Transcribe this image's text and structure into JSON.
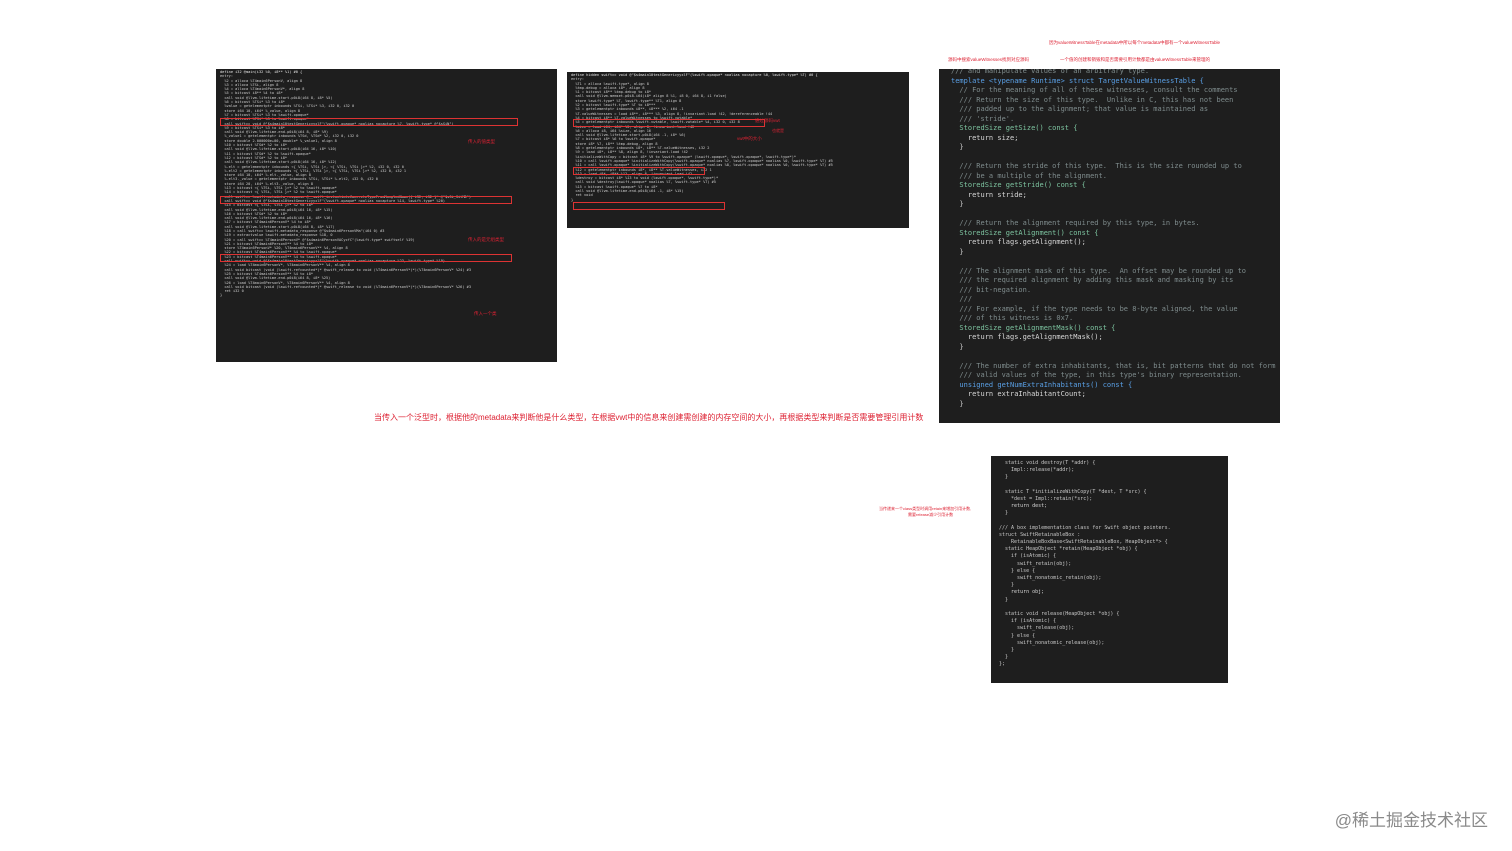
{
  "panel1": {
    "header": "define i32 @main(i32 %0, i8** %1) #0 {",
    "lines": [
      "entry:",
      "  %2 = alloca %T4main6PersonV, align 8",
      "  %3 = alloca %TSi, align 8",
      "  %4 = alloca %T4main6PersonV*, align 8",
      "  %5 = bitcast i8** %4 to i8*",
      "  call void @llvm.lifetime.start.p0i8(i64 8, i8* %5)",
      "  %6 = bitcast %TSi* %3 to i8*",
      "  %value = getelementptr inbounds %TSi, %TSi* %3, i32 0, i32 0",
      "  store i64 10, i64* %_value, align 8",
      "  %7 = bitcast %TSi* %3 to %swift.opaque*",
      "  %8 = bitcast %TSi* %3 to %swift.opaque*",
      "  call swiftcc void @\"$s4main10testGenericyyxlF\"(%swift.opaque* noalias nocapture %7, %swift.type* @\"$sSiN\")",
      "  %9 = bitcast %TSi* %3 to i8*",
      "  call void @llvm.lifetime.end.p0i8(i64 8, i8* %9)",
      "  %_value1 = getelementptr inbounds %TSd, %TSd* %2, i32 0, i32 0",
      "  store double 2.000000e+00, double* %_value1, align 8",
      "  %10 = bitcast %TSd* %2 to i8*",
      "  call void @llvm.lifetime.start.p0i8(i64 16, i8* %10)",
      "  %11 = bitcast %TSd* %2 to %swift.opaque*",
      "  %12 = bitcast %TSd* %2 to i8*",
      "  call void @llvm.lifetime.start.p0i8(i64 16, i8* %12)",
      "  %.elt = getelementptr inbounds <{ %TSi, %TSi }>, <{ %TSi, %TSi }>* %2, i32 0, i32 0",
      "  %.elt2 = getelementptr inbounds <{ %TSi, %TSi }>, <{ %TSi, %TSi }>* %2, i32 0, i32 1",
      "  store i64 10, i64* %.elt._value, align 8",
      "  %.elt3._value = getelementptr inbounds %TSi, %TSi* %.elt2, i32 0, i32 0",
      "  store i64 20, i64* %.elt3._value, align 8",
      "  %13 = bitcast <{ %TSi, %TSi }>* %2 to %swift.opaque*",
      "  %14 = bitcast <{ %TSi, %TSi }>* %2 to %swift.opaque*",
      "  call swiftcc %swift.metadata_response @__swift_instantiateConcreteTypeFromMangledName({ i32, i32 }* @\"$sSi_SitMD\")",
      "  call swiftcc void @\"$s4main10testGenericyyxlF\"(%swift.opaque* noalias nocapture %14, %swift.type* %20)",
      "  %15 = bitcast <{ %TSi, %TSi }>* %2 to i8*",
      "  call void @llvm.lifetime.end.p0i8(i64 16, i8* %15)",
      "  %16 = bitcast %TSd* %2 to i8*",
      "  call void @llvm.lifetime.end.p0i8(i64 16, i8* %16)",
      "  %17 = bitcast %T4main6PersonV* %4 to i8*",
      "  call void @llvm.lifetime.start.p0i8(i64 8, i8* %17)",
      "  %18 = call swiftcc %swift.metadata_response @\"$s4main6PersonVMa\"(i64 0) #3",
      "  %19 = extractvalue %swift.metadata_response %18, 0",
      "  %20 = call swiftcc %T4main6PersonV* @\"$s4main6PersonVACycfC\"(%swift.type* swiftself %19)",
      "  %21 = bitcast %T4main6PersonV** %4 to i8*",
      "  store %T4main6PersonV* %20, %T4main6PersonV** %4, align 8",
      "  %22 = bitcast %T4main6PersonV** %4 to %swift.opaque*",
      "  %23 = bitcast %T4main6PersonV** %4 to %swift.opaque*",
      "  call swiftcc void @\"$s4main10testGenericyyxlF\"(%swift.opaque* noalias nocapture %23, %swift.type* %19)",
      "  %24 = load %T4main6PersonV*, %T4main6PersonV** %4, align 8",
      "  call void bitcast (void (%swift.refcounted*)* @swift_release to void (%T4main6PersonV*)*)(%T4main6PersonV* %24) #3",
      "  %25 = bitcast %T4main6PersonV** %4 to i8*",
      "  call void @llvm.lifetime.end.p0i8(i64 8, i8* %25)",
      "  %26 = load %T4main6PersonV*, %T4main6PersonV** %4, align 8",
      "  call void bitcast (void (%swift.refcounted*)* @swift_release to void (%T4main6PersonV*)*)(%T4main6PersonV* %26) #3",
      "  ret i32 0",
      "}"
    ],
    "notes": [
      "传入的值类型",
      "传入的是元组类型",
      "传入一个类"
    ]
  },
  "panel2": {
    "header": "define hidden swiftcc void @\"$s4main10testGenericyyxlF\"(%swift.opaque* noalias nocapture %0, %swift.type* %T) #0 {",
    "lines": [
      "entry:",
      "  %T1 = alloca %swift.type*, align 8",
      "  %tmp.debug = alloca i8*, align 8",
      "  %1 = bitcast i8** %tmp.debug to i8*",
      "  call void @llvm.memset.p0i8.i64(i8* align 8 %1, i8 0, i64 8, i1 false)",
      "  store %swift.type* %T, %swift.type** %T1, align 8",
      "  %2 = bitcast %swift.type* %T to i8***",
      "  %3 = getelementptr inbounds i8**, i8*** %2, i64 -1",
      "  %T.valueWitnesses = load i8**, i8*** %3, align 8, !invariant.load !42, !dereferenceable !44",
      "  %4 = bitcast i8** %T.valueWitnesses to %swift.vwtable*",
      "  %5 = getelementptr inbounds %swift.vwtable, %swift.vwtable* %4, i32 0, i32 8",
      "  %size = load i64, i64* %5, align 8, !invariant.load !42",
      "  %6 = alloca i8, i64 %size, align 16",
      "  call void @llvm.lifetime.start.p0i8(i64 -1, i8* %6)",
      "  %7 = bitcast i8* %6 to %swift.opaque*",
      "  store i8* %7, i8** %tmp.debug, align 8",
      "  %8 = getelementptr inbounds i8*, i8** %T.valueWitnesses, i32 2",
      "  %9 = load i8*, i8** %8, align 8, !invariant.load !42",
      "  %initializeWithCopy = bitcast i8* %9 to %swift.opaque* (%swift.opaque*, %swift.opaque*, %swift.type*)*",
      "  %10 = call %swift.opaque* %initializeWithCopy(%swift.opaque* noalias %7, %swift.opaque* noalias %0, %swift.type* %T) #5",
      "  %11 = call %swift.opaque* %initializeWithCopy(%swift.opaque* noalias %8, %swift.opaque* noalias %0, %swift.type* %T) #5",
      "  %12 = getelementptr inbounds i8*, i8** %T.valueWitnesses, i32 1",
      "  %13 = load i8*, i8** %12, align 8, !invariant.load !42",
      "  %destroy = bitcast i8* %13 to void (%swift.opaque*, %swift.type*)*",
      "  call void %destroy(%swift.opaque* noalias %7, %swift.type* %T) #5",
      "  %15 = bitcast %swift.opaque* %7 to i8*",
      "  call void @llvm.lifetime.end.p0i8(i64 -1, i8* %15)",
      "  ret void",
      "}"
    ],
    "notes": [
      "通过源码vwt",
      "vwt中的大小",
      "也就是"
    ]
  },
  "panel3": {
    "lines": [
      "/// and manipulate values of an arbitrary type.",
      "template <typename Runtime> struct TargetValueWitnessTable {",
      "  // For the meaning of all of these witnesses, consult the comments",
      "  /// Return the size of this type.  Unlike in C, this has not been",
      "  /// padded up to the alignment; that value is maintained as",
      "  /// 'stride'.",
      "  StoredSize getSize() const {",
      "    return size;",
      "  }",
      "",
      "  /// Return the stride of this type.  This is the size rounded up to",
      "  /// be a multiple of the alignment.",
      "  StoredSize getStride() const {",
      "    return stride;",
      "  }",
      "",
      "  /// Return the alignment required by this type, in bytes.",
      "  StoredSize getAlignment() const {",
      "    return flags.getAlignment();",
      "  }",
      "",
      "  /// The alignment mask of this type.  An offset may be rounded up to",
      "  /// the required alignment by adding this mask and masking by its",
      "  /// bit-negation.",
      "  ///",
      "  /// For example, if the type needs to be 8-byte aligned, the value",
      "  /// of this witness is 0x7.",
      "  StoredSize getAlignmentMask() const {",
      "    return flags.getAlignmentMask();",
      "  }",
      "",
      "  /// The number of extra inhabitants, that is, bit patterns that do not form",
      "  /// valid values of the type, in this type's binary representation.",
      "  unsigned getNumExtraInhabitants() const {",
      "    return extraInhabitantCount;",
      "  }"
    ]
  },
  "panel4": {
    "lines": [
      "  static void destroy(T *addr) {",
      "    Impl::release(*addr);",
      "  }",
      "",
      "  static T *initializeWithCopy(T *dest, T *src) {",
      "    *dest = Impl::retain(*src);",
      "    return dest;",
      "  }",
      "",
      "/// A box implementation class for Swift object pointers.",
      "struct SwiftRetainableBox :",
      "    RetainableBoxBase<SwiftRetainableBox, HeapObject*> {",
      "  static HeapObject *retain(HeapObject *obj) {",
      "    if (isAtomic) {",
      "      swift_retain(obj);",
      "    } else {",
      "      swift_nonatomic_retain(obj);",
      "    }",
      "    return obj;",
      "  }",
      "",
      "  static void release(HeapObject *obj) {",
      "    if (isAtomic) {",
      "      swift_release(obj);",
      "    } else {",
      "      swift_nonatomic_release(obj);",
      "    }",
      "  }",
      "};"
    ]
  },
  "annotations": {
    "top1": "因为valueWitnessTable在metadata中所以每个metadata中都有一个valueWitnessTable",
    "top2": "源码中搜索valueWitnesses找到对应源码",
    "top3": "一个值的创建和销毁和是否需要引用计数都是由valueWitnessTable来管理的",
    "left4_line1": "当传递来一个class类型时调用retain来增加引用计数,",
    "left4_line2": "需要release减少引用计数"
  },
  "caption": "当传入一个泛型时，根据他的metadata来判断他是什么类型，在根据vwt中的信息来创建需创建的内存空间的大小，再根据类型来判断是否需要管理引用计数",
  "watermark": "@稀土掘金技术社区",
  "colors": {
    "panel_bg": "#1e1e1e",
    "annotation_red": "#dd2233"
  }
}
